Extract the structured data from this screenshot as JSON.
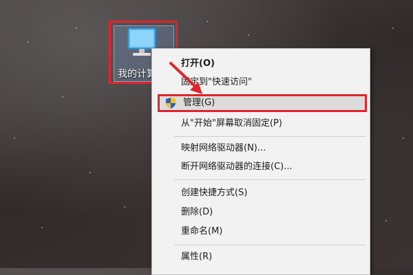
{
  "desktop": {
    "icon_label": "我的计算机"
  },
  "menu": {
    "items": [
      {
        "label": "打开(O)"
      },
      {
        "label": "固定到\"快速访问\""
      },
      {
        "label": "管理(G)"
      },
      {
        "label": "从\"开始\"屏幕取消固定(P)"
      },
      {
        "label": "映射网络驱动器(N)..."
      },
      {
        "label": "断开网络驱动器的连接(C)..."
      },
      {
        "label": "创建快捷方式(S)"
      },
      {
        "label": "删除(D)"
      },
      {
        "label": "重命名(M)"
      },
      {
        "label": "属性(R)"
      }
    ]
  },
  "colors": {
    "highlight_border": "#e0242b",
    "menu_bg": "#f2f2f2"
  },
  "icons": [
    "computer-icon",
    "uac-shield-icon",
    "red-arrow"
  ]
}
